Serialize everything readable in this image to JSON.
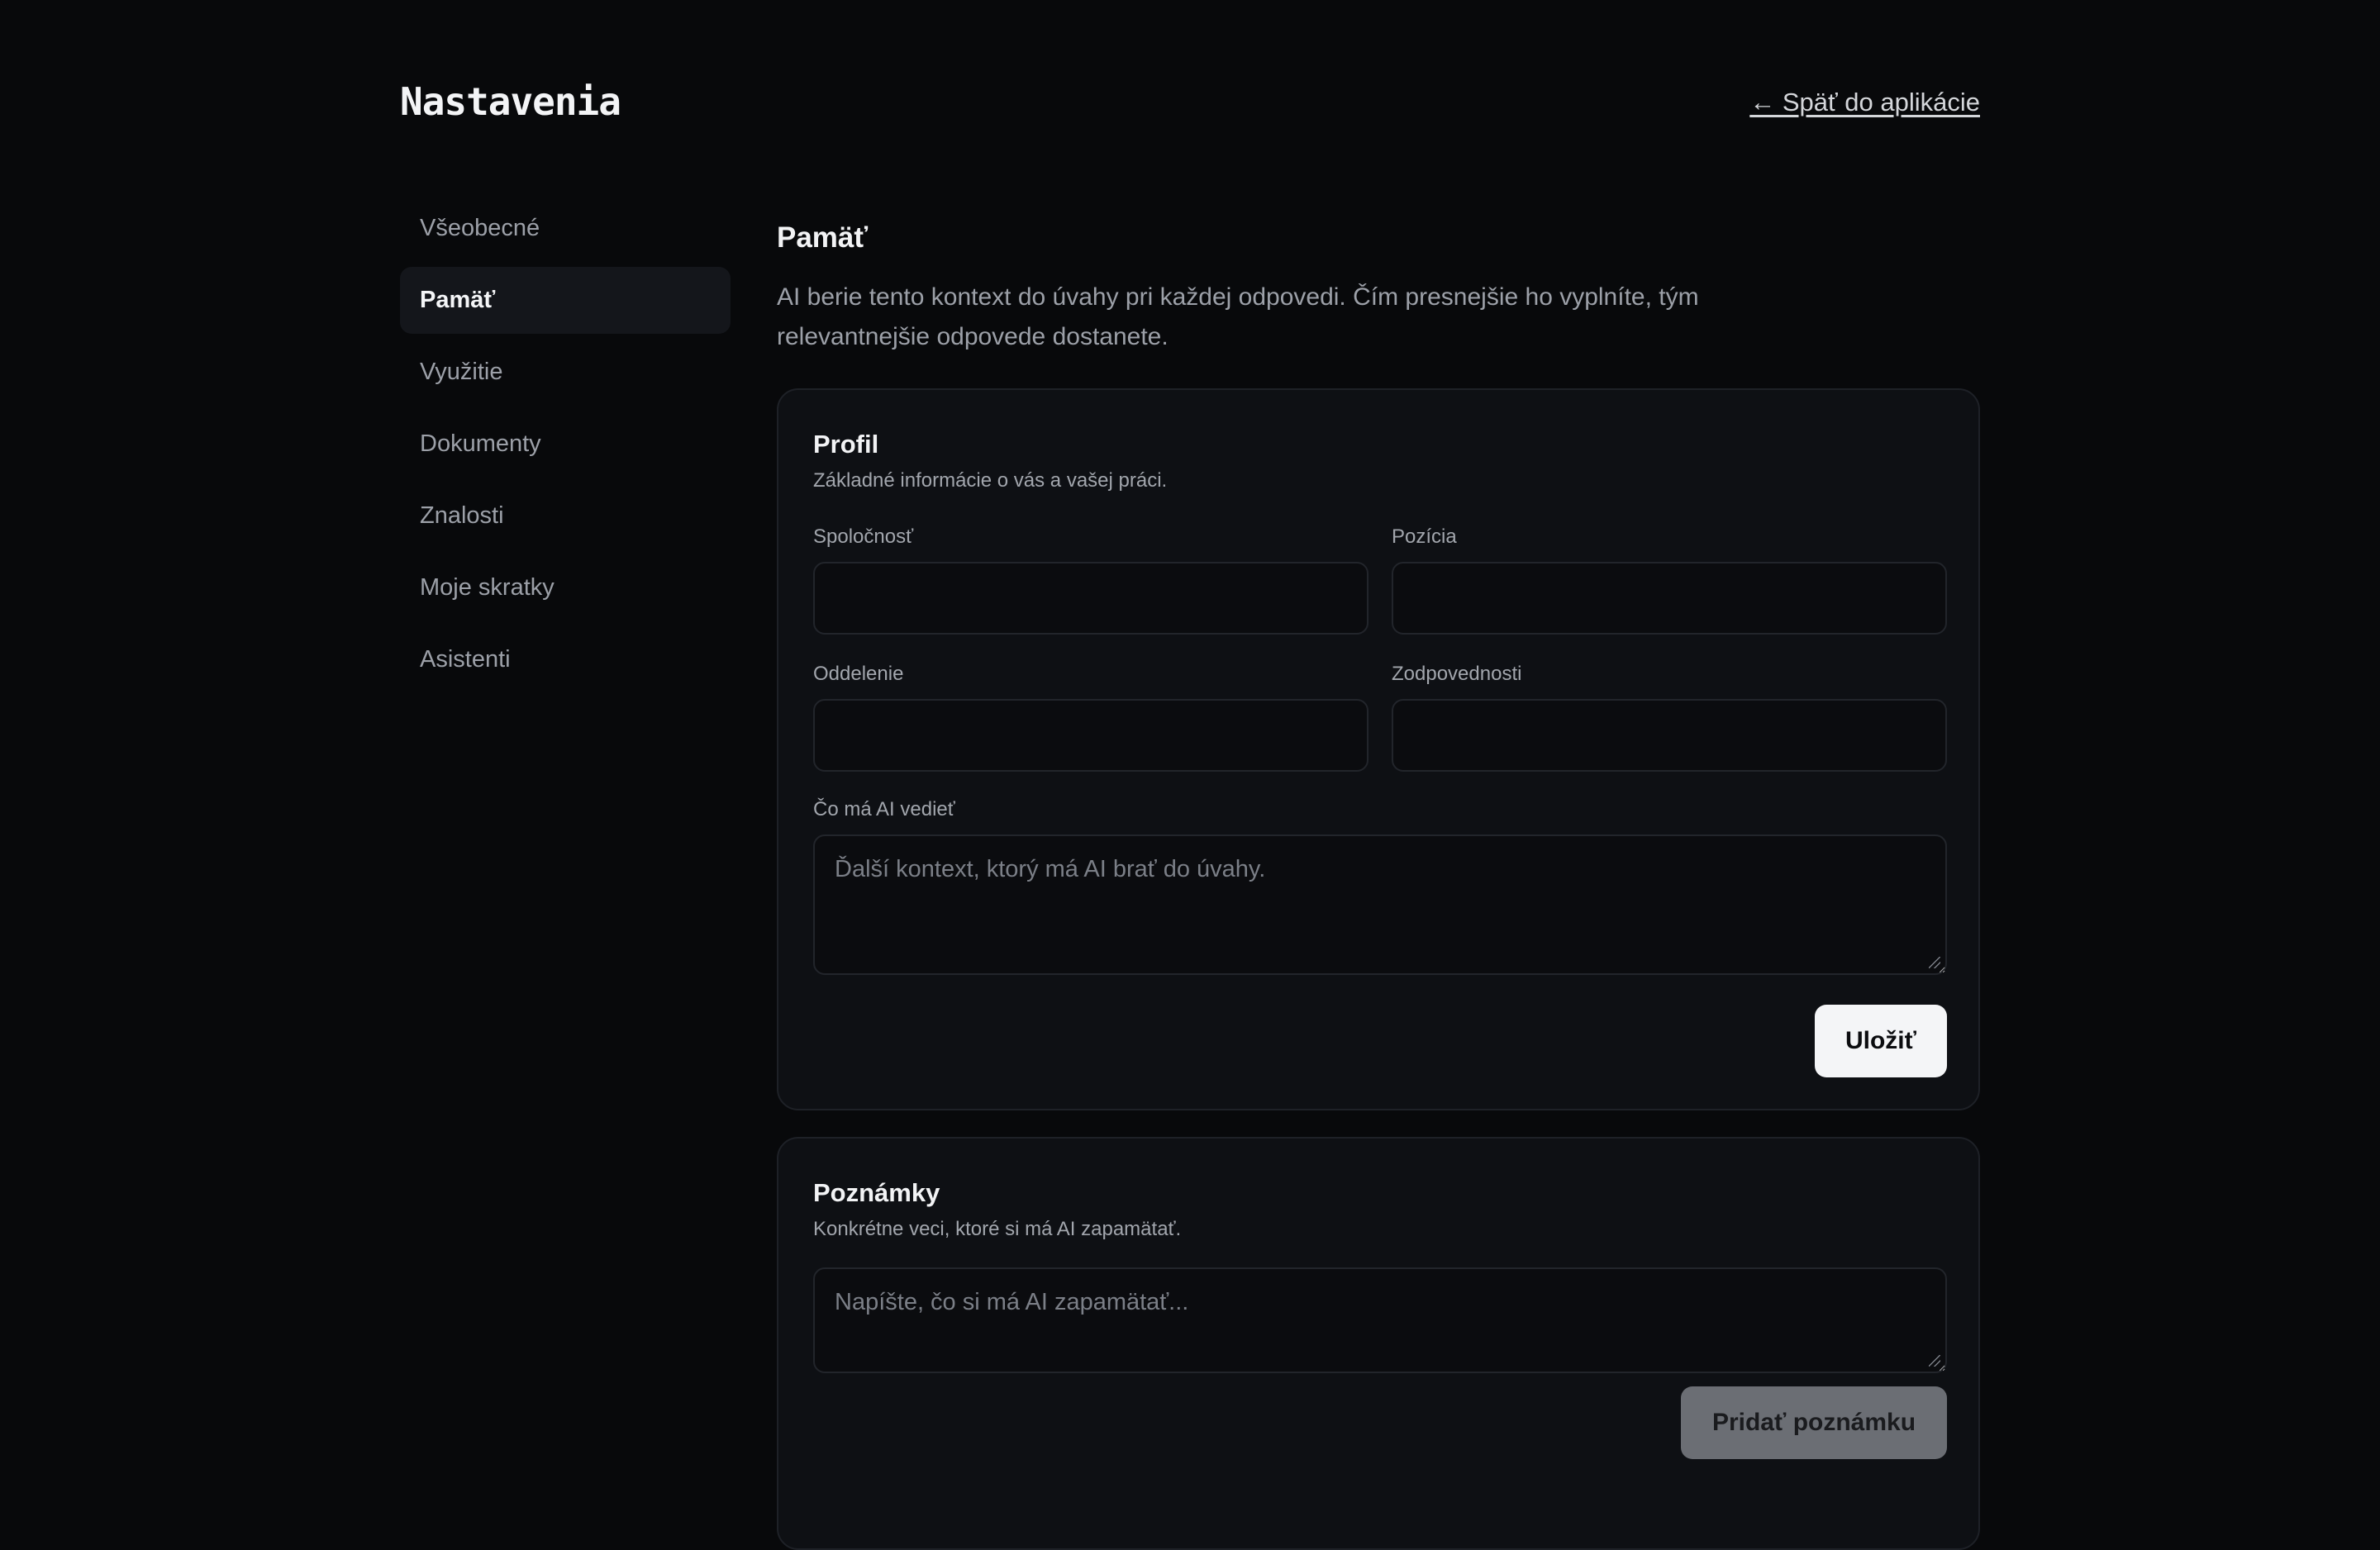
{
  "header": {
    "title": "Nastavenia",
    "back_link": "← Späť do aplikácie"
  },
  "sidebar": {
    "items": [
      {
        "label": "Všeobecné",
        "active": false
      },
      {
        "label": "Pamäť",
        "active": true
      },
      {
        "label": "Využitie",
        "active": false
      },
      {
        "label": "Dokumenty",
        "active": false
      },
      {
        "label": "Znalosti",
        "active": false
      },
      {
        "label": "Moje skratky",
        "active": false
      },
      {
        "label": "Asistenti",
        "active": false
      }
    ]
  },
  "main": {
    "title": "Pamäť",
    "description": "AI berie tento kontext do úvahy pri každej odpovedi. Čím presnejšie ho vyplníte, tým relevantnejšie odpovede dostanete.",
    "profile": {
      "title": "Profil",
      "subtitle": "Základné informácie o vás a vašej práci.",
      "company_label": "Spoločnosť",
      "company_value": "",
      "position_label": "Pozícia",
      "position_value": "",
      "department_label": "Oddelenie",
      "department_value": "",
      "responsibilities_label": "Zodpovednosti",
      "responsibilities_value": "",
      "context_label": "Čo má AI vedieť",
      "context_placeholder": "Ďalší kontext, ktorý má AI brať do úvahy.",
      "save_label": "Uložiť"
    },
    "notes": {
      "title": "Poznámky",
      "subtitle": "Konkrétne veci, ktoré si má AI zapamätať.",
      "note_placeholder": "Napíšte, čo si má AI zapamätať...",
      "add_label": "Pridať poznámku"
    }
  },
  "colors": {
    "background": "#08090b",
    "card": "#0e1014",
    "primary_button": "#f4f5f7",
    "disabled_button": "#6b6e74"
  }
}
